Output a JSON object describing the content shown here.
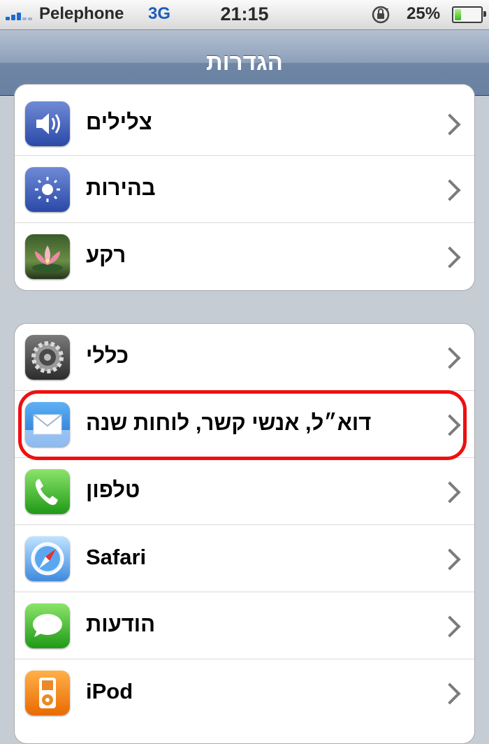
{
  "status_bar": {
    "carrier": "Pelephone",
    "network": "3G",
    "time": "21:15",
    "battery_percent": "25%",
    "battery_level": 0.25,
    "icons": [
      "signal-icon",
      "rotation-lock-icon",
      "battery-icon"
    ]
  },
  "nav": {
    "title": "הגדרות"
  },
  "groups": [
    {
      "rows": [
        {
          "label": "צלילים",
          "icon": "speaker-icon"
        },
        {
          "label": "בהירות",
          "icon": "brightness-icon"
        },
        {
          "label": "רקע",
          "icon": "wallpaper-icon"
        }
      ]
    },
    {
      "rows": [
        {
          "label": "כללי",
          "icon": "gear-icon"
        },
        {
          "label": "דוא״ל, אנשי קשר, לוחות שנה",
          "icon": "mail-icon"
        },
        {
          "label": "טלפון",
          "icon": "phone-icon"
        },
        {
          "label": "Safari",
          "icon": "safari-compass-icon"
        },
        {
          "label": "הודעות",
          "icon": "messages-bubble-icon"
        },
        {
          "label": "iPod",
          "icon": "ipod-icon"
        }
      ]
    }
  ],
  "colors": {
    "highlight": "#ee1010",
    "nav_bar": "#6e85a4",
    "background": "#c5ccd4"
  }
}
